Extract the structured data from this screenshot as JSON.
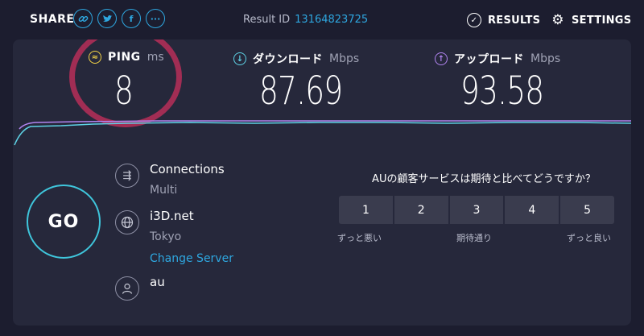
{
  "header": {
    "share_label": "SHARE",
    "share_icons": [
      "link-icon",
      "twitter-icon",
      "facebook-icon",
      "more-icon"
    ],
    "result_id_label": "Result ID",
    "result_id": "13164823725",
    "results_label": "RESULTS",
    "settings_label": "SETTINGS"
  },
  "metrics": {
    "ping": {
      "label": "PING",
      "unit": "ms",
      "value": "8",
      "icon_color": "#f5d547"
    },
    "download": {
      "label": "ダウンロード",
      "unit": "Mbps",
      "value": "87.69",
      "icon_color": "#5ed3e6"
    },
    "upload": {
      "label": "アップロード",
      "unit": "Mbps",
      "value": "93.58",
      "icon_color": "#b184f0"
    }
  },
  "go_label": "GO",
  "connections": {
    "title": "Connections",
    "value": "Multi"
  },
  "server": {
    "name": "i3D.net",
    "location": "Tokyo",
    "change_label": "Change Server"
  },
  "isp": {
    "name": "au"
  },
  "survey": {
    "question": "AUの顧客サービスは期待と比べてどうですか？",
    "options": [
      "1",
      "2",
      "3",
      "4",
      "5"
    ],
    "low_label": "ずっと悪い",
    "mid_label": "期待通り",
    "high_label": "ずっと良い"
  },
  "colors": {
    "accent": "#2ea7e0",
    "go_ring": "#3fc6dc",
    "highlight_circle": "#a12d54",
    "download_line": "#5ed3e6",
    "upload_line": "#b184f0"
  }
}
